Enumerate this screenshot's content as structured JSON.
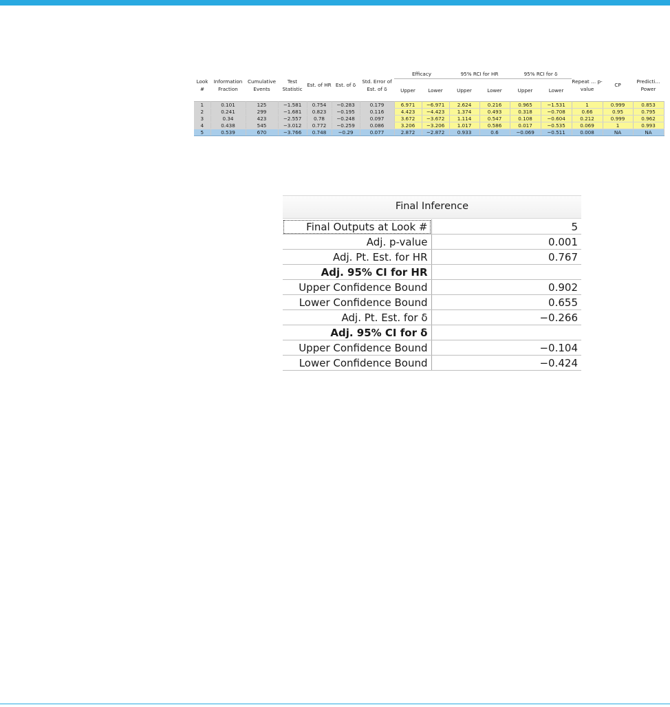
{
  "monitor_table": {
    "headers": {
      "look": "Look #",
      "info_fraction": "Information Fraction",
      "cum_events": "Cumulative Events",
      "test_stat": "Test Statistic",
      "est_hr": "Est. of HR",
      "est_delta": "Est. of δ",
      "se_delta": "Std. Error of Est. of δ",
      "efficacy": "Efficacy",
      "rci_hr": "95% RCI for HR",
      "rci_delta": "95% RCI for δ",
      "upper": "Upper",
      "lower": "Lower",
      "repeat_p": "Repeat … p-value",
      "cp": "CP",
      "pred_power": "Predicti… Power"
    },
    "rows": [
      [
        "1",
        "0.101",
        "125",
        "-1.581",
        "0.754",
        "-0.283",
        "0.179",
        "6.971",
        "-6.971",
        "2.624",
        "0.216",
        "0.965",
        "-1.531",
        "1",
        "0.999",
        "0.853"
      ],
      [
        "2",
        "0.241",
        "299",
        "-1.681",
        "0.823",
        "-0.195",
        "0.116",
        "4.423",
        "-4.423",
        "1.374",
        "0.493",
        "0.318",
        "-0.708",
        "0.66",
        "0.95",
        "0.795"
      ],
      [
        "3",
        "0.34",
        "423",
        "-2.557",
        "0.78",
        "-0.248",
        "0.097",
        "3.672",
        "-3.672",
        "1.114",
        "0.547",
        "0.108",
        "-0.604",
        "0.212",
        "0.999",
        "0.962"
      ],
      [
        "4",
        "0.438",
        "545",
        "-3.012",
        "0.772",
        "-0.259",
        "0.086",
        "3.206",
        "-3.206",
        "1.017",
        "0.586",
        "0.017",
        "-0.535",
        "0.069",
        "1",
        "0.993"
      ],
      [
        "5",
        "0.539",
        "670",
        "-3.766",
        "0.748",
        "-0.29",
        "0.077",
        "2.872",
        "-2.872",
        "0.933",
        "0.6",
        "-0.069",
        "-0.511",
        "0.008",
        "NA",
        "NA"
      ]
    ],
    "selected_row": 4
  },
  "final_inference": {
    "title": "Final Inference",
    "rows": [
      {
        "label": "Final Outputs at Look #",
        "value": "5"
      },
      {
        "label": "Adj. p-value",
        "value": "0.001"
      },
      {
        "label": "Adj. Pt. Est. for HR",
        "value": "0.767"
      },
      {
        "label": "Adj. 95% CI for HR",
        "value": ""
      },
      {
        "label": "Upper Confidence Bound",
        "value": "0.902"
      },
      {
        "label": "Lower Confidence Bound",
        "value": "0.655"
      },
      {
        "label": "Adj. Pt. Est. for δ",
        "value": "-0.266"
      },
      {
        "label": "Adj. 95% CI for δ",
        "value": ""
      },
      {
        "label": "Upper Confidence Bound",
        "value": "-0.104"
      },
      {
        "label": "Lower Confidence Bound",
        "value": "-0.424"
      }
    ]
  },
  "colors": {
    "accent": "#29a9e1",
    "grey_cell": "#d4d4d4",
    "yellow_cell": "#fbf895",
    "selected_row": "#a9cdea"
  }
}
